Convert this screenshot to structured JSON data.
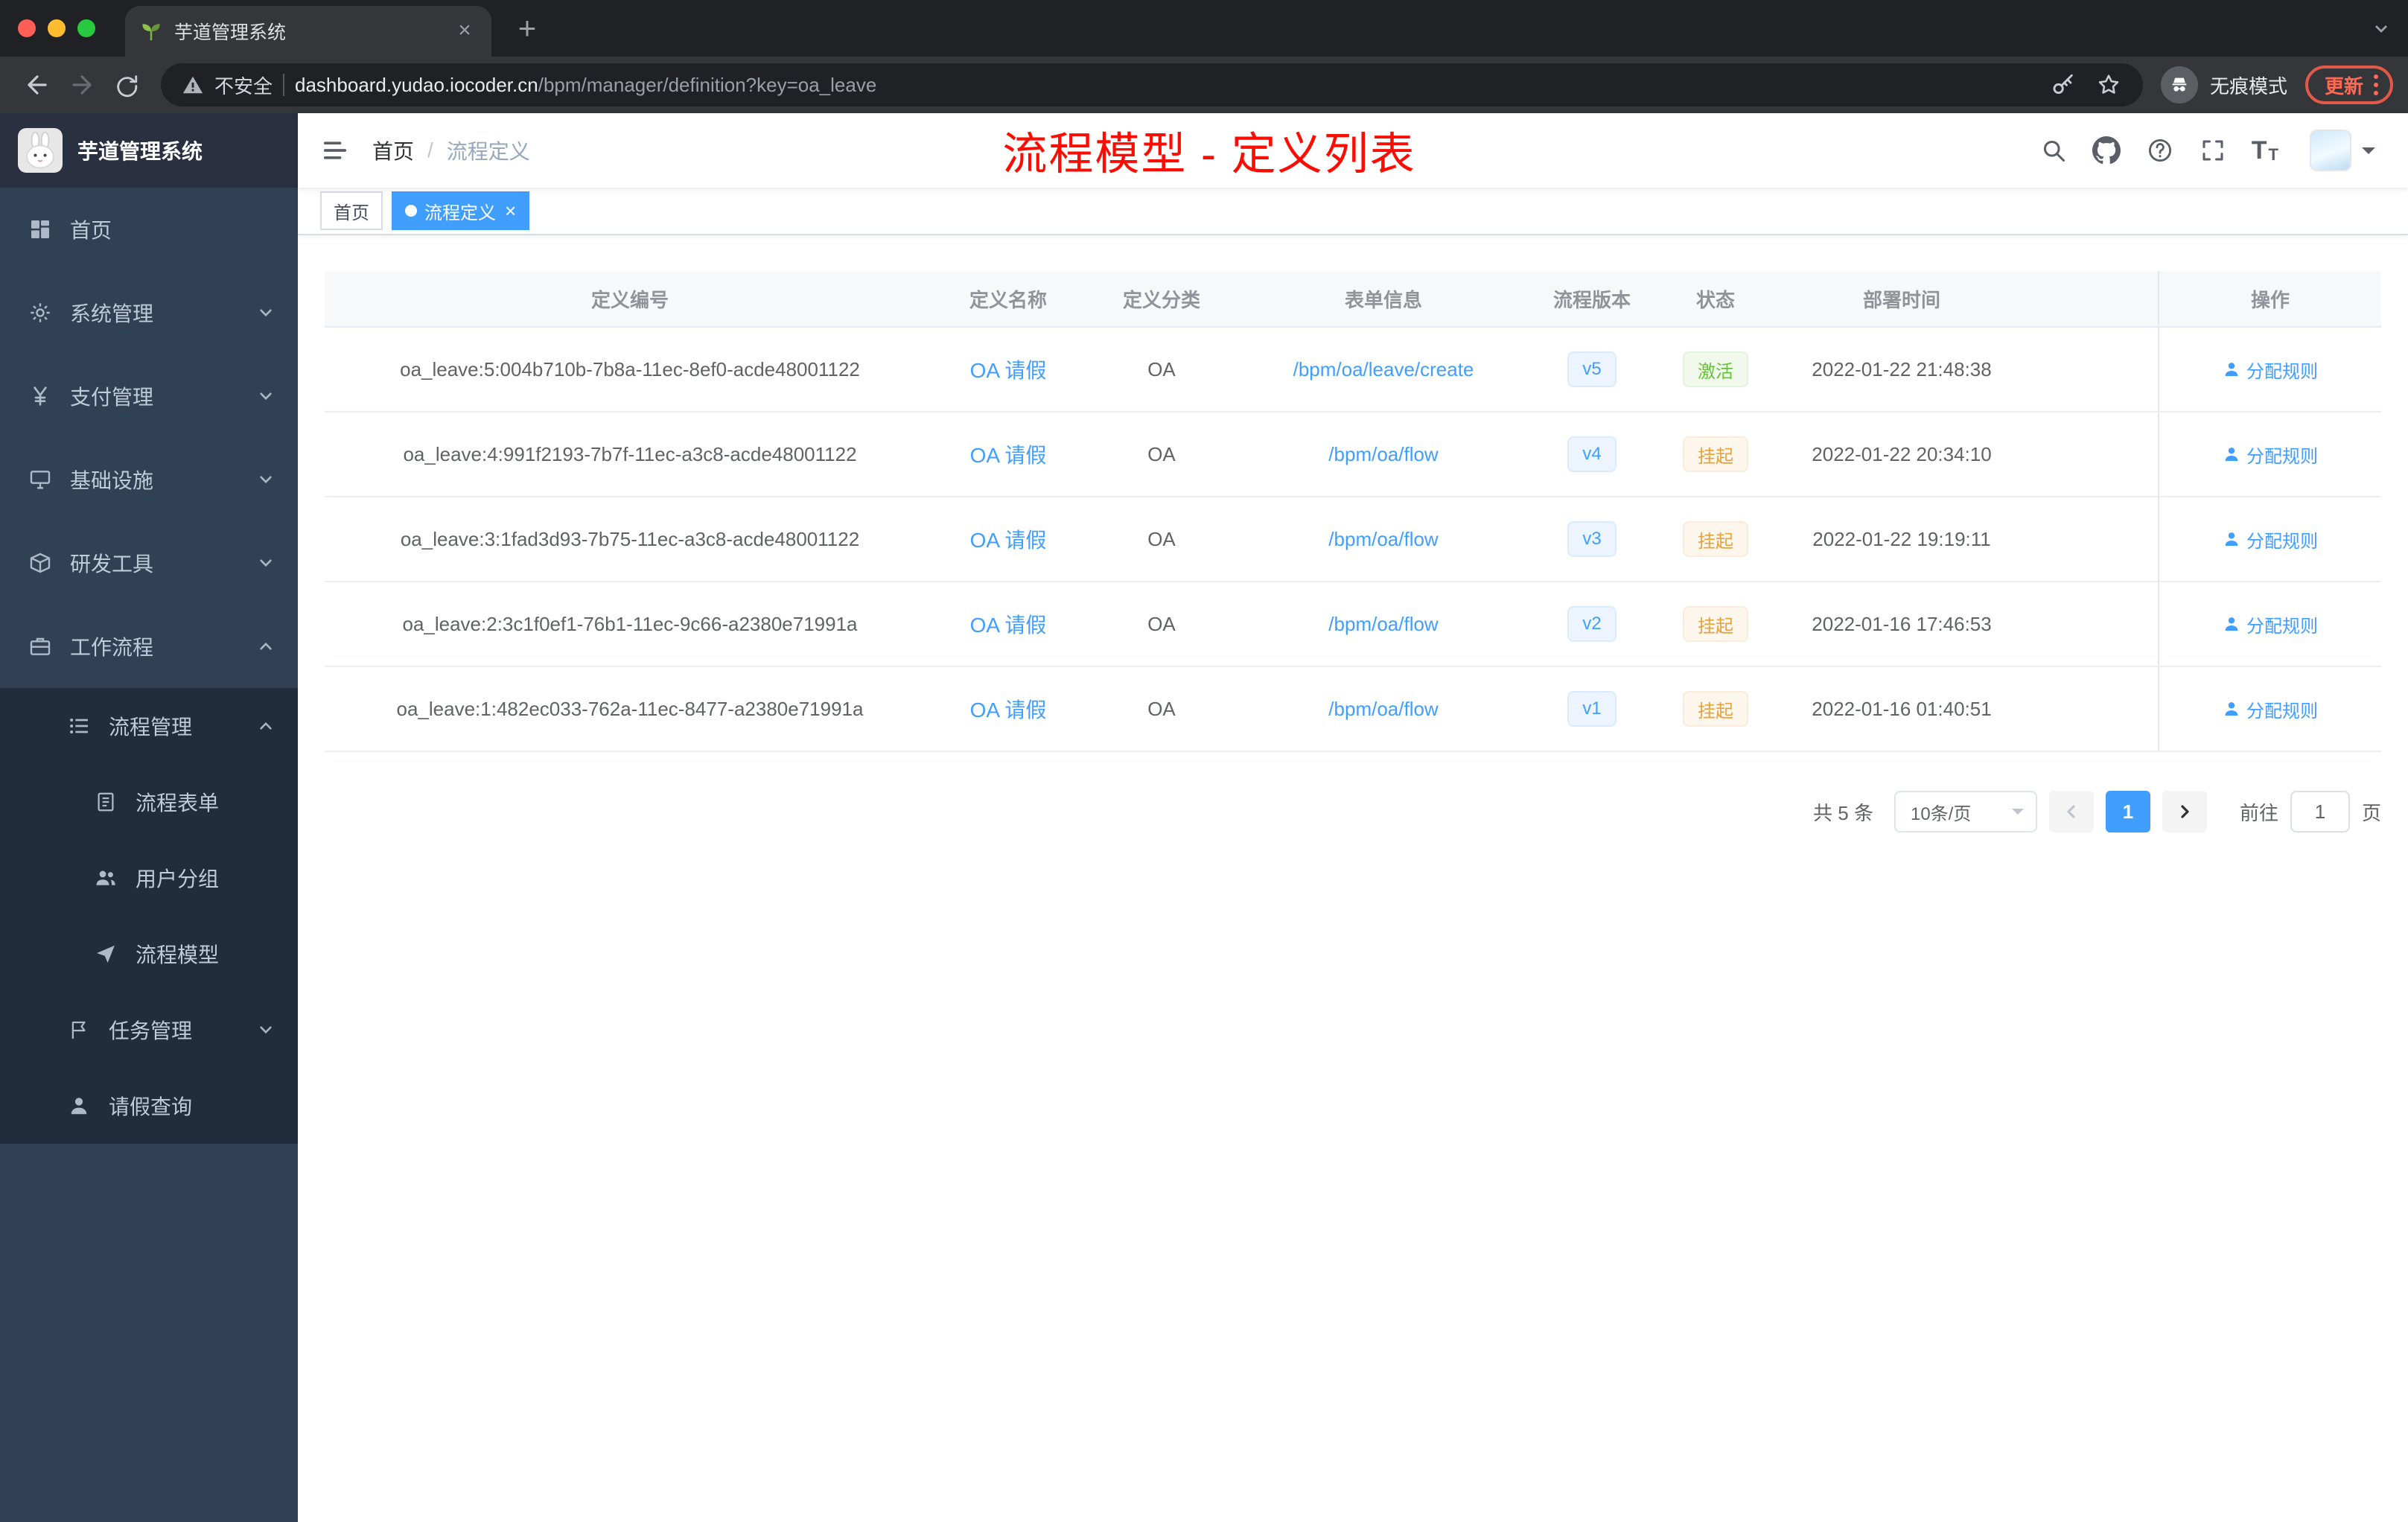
{
  "browser": {
    "tab_title": "芋道管理系统",
    "security_label": "不安全",
    "url_host": "dashboard.yudao.iocoder.cn",
    "url_path": "/bpm/manager/definition?key=oa_leave",
    "incognito_label": "无痕模式",
    "update_label": "更新"
  },
  "sidebar": {
    "logo_title": "芋道管理系统",
    "items": [
      {
        "icon": "home-icon",
        "label": "首页",
        "level": 0,
        "chevron": ""
      },
      {
        "icon": "gear-icon",
        "label": "系统管理",
        "level": 0,
        "chevron": "down"
      },
      {
        "icon": "yen-icon",
        "label": "支付管理",
        "level": 0,
        "chevron": "down"
      },
      {
        "icon": "infrastructure-icon",
        "label": "基础设施",
        "level": 0,
        "chevron": "down"
      },
      {
        "icon": "tools-icon",
        "label": "研发工具",
        "level": 0,
        "chevron": "down"
      },
      {
        "icon": "workflow-icon",
        "label": "工作流程",
        "level": 0,
        "chevron": "up"
      },
      {
        "icon": "process-list-icon",
        "label": "流程管理",
        "level": 1,
        "chevron": "up"
      },
      {
        "icon": "form-icon",
        "label": "流程表单",
        "level": 2,
        "chevron": ""
      },
      {
        "icon": "user-group-icon",
        "label": "用户分组",
        "level": 2,
        "chevron": ""
      },
      {
        "icon": "send-icon",
        "label": "流程模型",
        "level": 2,
        "chevron": ""
      },
      {
        "icon": "task-icon",
        "label": "任务管理",
        "level": 1,
        "chevron": "down"
      },
      {
        "icon": "user-icon",
        "label": "请假查询",
        "level": 1,
        "chevron": ""
      }
    ]
  },
  "header": {
    "breadcrumb": [
      "首页",
      "流程定义"
    ],
    "breadcrumb_separator": "/",
    "annotation": "流程模型 - 定义列表"
  },
  "tags": [
    {
      "label": "首页",
      "active": false
    },
    {
      "label": "流程定义",
      "active": true
    }
  ],
  "table": {
    "columns": [
      "定义编号",
      "定义名称",
      "定义分类",
      "表单信息",
      "流程版本",
      "状态",
      "部署时间",
      "操作"
    ],
    "rows": [
      {
        "id": "oa_leave:5:004b710b-7b8a-11ec-8ef0-acde48001122",
        "name": "OA 请假",
        "category": "OA",
        "form": "/bpm/oa/leave/create",
        "version": "v5",
        "status": "激活",
        "status_type": "success",
        "time": "2022-01-22 21:48:38",
        "action": "分配规则"
      },
      {
        "id": "oa_leave:4:991f2193-7b7f-11ec-a3c8-acde48001122",
        "name": "OA 请假",
        "category": "OA",
        "form": "/bpm/oa/flow",
        "version": "v4",
        "status": "挂起",
        "status_type": "warning",
        "time": "2022-01-22 20:34:10",
        "action": "分配规则"
      },
      {
        "id": "oa_leave:3:1fad3d93-7b75-11ec-a3c8-acde48001122",
        "name": "OA 请假",
        "category": "OA",
        "form": "/bpm/oa/flow",
        "version": "v3",
        "status": "挂起",
        "status_type": "warning",
        "time": "2022-01-22 19:19:11",
        "action": "分配规则"
      },
      {
        "id": "oa_leave:2:3c1f0ef1-76b1-11ec-9c66-a2380e71991a",
        "name": "OA 请假",
        "category": "OA",
        "form": "/bpm/oa/flow",
        "version": "v2",
        "status": "挂起",
        "status_type": "warning",
        "time": "2022-01-16 17:46:53",
        "action": "分配规则"
      },
      {
        "id": "oa_leave:1:482ec033-762a-11ec-8477-a2380e71991a",
        "name": "OA 请假",
        "category": "OA",
        "form": "/bpm/oa/flow",
        "version": "v1",
        "status": "挂起",
        "status_type": "warning",
        "time": "2022-01-16 01:40:51",
        "action": "分配规则"
      }
    ]
  },
  "pagination": {
    "total": "共 5 条",
    "page_size": "10条/页",
    "current_page": "1",
    "goto_label": "前往",
    "goto_value": "1",
    "page_unit": "页"
  },
  "colors": {
    "accent": "#409eff",
    "success": "#67c23a",
    "warning": "#e6a23c",
    "sidebar_bg": "#304156",
    "submenu_bg": "#1f2d3d",
    "annotation_red": "#fc0d04"
  },
  "icons": {
    "tab-favicon-icon": "seedling",
    "not-secure-icon": "warning-triangle",
    "password-key-icon": "key",
    "bookmark-star-icon": "star-outline",
    "incognito-icon": "spy",
    "chrome-menu-icon": "vertical-dots",
    "search-icon": "magnifier",
    "github-icon": "octocat",
    "help-icon": "question-circle",
    "fullscreen-icon": "expand-corners",
    "font-size-icon": "double-T",
    "assign-rule-icon": "person"
  }
}
